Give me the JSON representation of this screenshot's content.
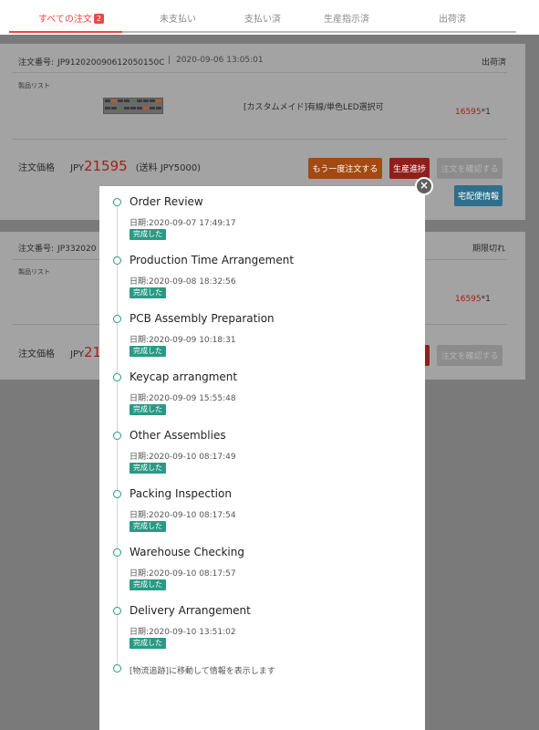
{
  "tabs": [
    {
      "label": "すべての注文",
      "badge": "2",
      "active": true
    },
    {
      "label": "未支払い"
    },
    {
      "label": "支払い済"
    },
    {
      "label": "生産指示済"
    },
    {
      "label": "出荷済"
    }
  ],
  "orders": [
    {
      "number_label": "注文番号:",
      "number": "JP912020090612050150C",
      "separator": "|",
      "date": "2020-09-06 13:05:01",
      "status": "出荷済",
      "products_label": "製品リスト",
      "product_name": "[カスタムメイド]有線/単色LED選択可",
      "product_price": "16595",
      "product_qty": "*1",
      "total_label": "注文価格",
      "total_currency": "JPY",
      "total_amount": "21595",
      "shipping": "(送料 JPY5000)",
      "buttons": {
        "reorder": "もう一度注文する",
        "progress": "生産進捗",
        "confirm": "注文を確認する",
        "delivery": "宅配便情報"
      }
    },
    {
      "number_label": "注文番号:",
      "number": "JP332020",
      "status": "期限切れ",
      "products_label": "製品リスト",
      "product_price": "16595",
      "product_qty": "*1",
      "total_label": "注文価格",
      "total_currency": "JPY",
      "total_amount": "21",
      "buttons": {
        "confirm": "注文を確認する"
      }
    }
  ],
  "modal": {
    "close_icon": "×",
    "steps": [
      {
        "title": "Order Review",
        "date": "日期:2020-09-07 17:49:17",
        "badge": "完成した"
      },
      {
        "title": "Production Time Arrangement",
        "date": "日期:2020-09-08 18:32:56",
        "badge": "完成した"
      },
      {
        "title": "PCB Assembly Preparation",
        "date": "日期:2020-09-09 10:18:31",
        "badge": "完成した"
      },
      {
        "title": "Keycap arrangment",
        "date": "日期:2020-09-09 15:55:48",
        "badge": "完成した"
      },
      {
        "title": "Other Assemblies",
        "date": "日期:2020-09-10 08:17:49",
        "badge": "完成した"
      },
      {
        "title": "Packing Inspection",
        "date": "日期:2020-09-10 08:17:54",
        "badge": "完成した"
      },
      {
        "title": "Warehouse Checking",
        "date": "日期:2020-09-10 08:17:57",
        "badge": "完成した"
      },
      {
        "title": "Delivery Arrangement",
        "date": "日期:2020-09-10 13:51:02",
        "badge": "完成した"
      }
    ],
    "footer_note": "[物流追跡]に移動して情報を表示します"
  },
  "colors": {
    "accent_red": "#e94a3f",
    "teal": "#2a9a85",
    "overlay": "#7a7a7a"
  }
}
